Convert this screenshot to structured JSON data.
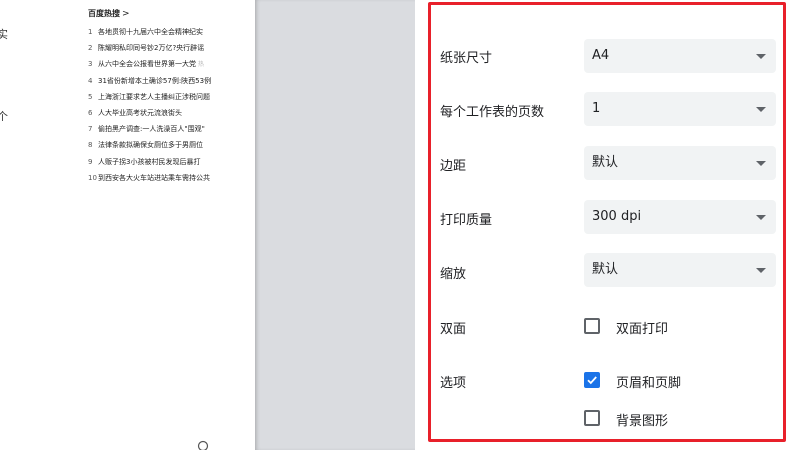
{
  "preview": {
    "edge_chars": [
      "实",
      "个"
    ],
    "hot_title": "百度热搜",
    "hot_chevron": ">",
    "hot_items": [
      {
        "num": "1",
        "text": "各地贯彻十九届六中全会精神纪实"
      },
      {
        "num": "2",
        "text": "陈耀明私印同号钞2万亿?央行辟谣"
      },
      {
        "num": "3",
        "text": "从六中全会公报看世界第一大党"
      },
      {
        "num": "4",
        "text": "31省份新增本土确诊57例:陕西53例"
      },
      {
        "num": "5",
        "text": "上海浙江要求艺人主播纠正涉税问题"
      },
      {
        "num": "6",
        "text": "人大毕业高考状元流浪街头"
      },
      {
        "num": "7",
        "text": "偷拍黑产调查:一人洗澡百人\"围观\""
      },
      {
        "num": "8",
        "text": "法律条款拟确保女厕位多于男厕位"
      },
      {
        "num": "9",
        "text": "人贩子拐3小孩被村民发现后暴打"
      },
      {
        "num": "10",
        "text": "到西安各大火车站进站乘车需持公共"
      }
    ],
    "hot_tail_3": "热"
  },
  "settings": {
    "paper_size": {
      "label": "纸张尺寸",
      "value": "A4"
    },
    "pages_per_sheet": {
      "label": "每个工作表的页数",
      "value": "1"
    },
    "margins": {
      "label": "边距",
      "value": "默认"
    },
    "quality": {
      "label": "打印质量",
      "value": "300 dpi"
    },
    "scale": {
      "label": "缩放",
      "value": "默认"
    },
    "duplex": {
      "label": "双面",
      "option": "双面打印",
      "checked": false
    },
    "options": {
      "label": "选项",
      "headers_footers": {
        "label": "页眉和页脚",
        "checked": true
      },
      "background_graphics": {
        "label": "背景图形",
        "checked": false
      }
    }
  },
  "colors": {
    "highlight": "#e8202a",
    "check_accent": "#1a73e8",
    "gutter": "#dadce0"
  }
}
